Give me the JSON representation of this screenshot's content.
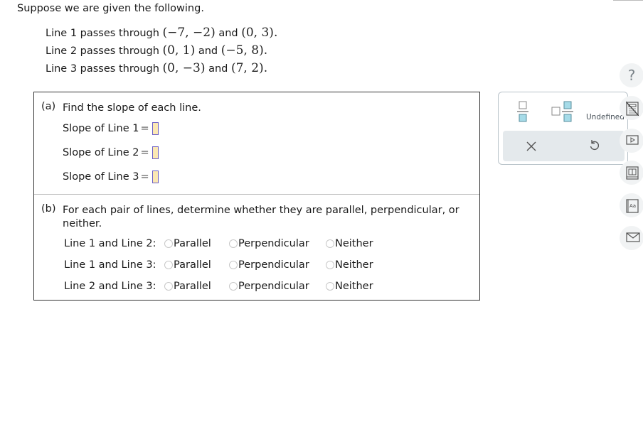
{
  "intro": "Suppose we are given the following.",
  "lines": [
    {
      "prefix": "Line 1 passes through",
      "p1": "(−7, −2)",
      "and": "and",
      "p2": "(0, 3)",
      "end": "."
    },
    {
      "prefix": "Line 2 passes through",
      "p1": "(0, 1)",
      "and": "and",
      "p2": "(−5, 8)",
      "end": "."
    },
    {
      "prefix": "Line 3 passes through",
      "p1": "(0, −3)",
      "and": "and",
      "p2": "(7, 2)",
      "end": "."
    }
  ],
  "part_a": {
    "label": "(a)",
    "text": "Find the slope of each line.",
    "rows": [
      {
        "label": "Slope of Line 1",
        "eq": "=",
        "value": ""
      },
      {
        "label": "Slope of Line 2",
        "eq": "=",
        "value": ""
      },
      {
        "label": "Slope of Line 3",
        "eq": "=",
        "value": ""
      }
    ]
  },
  "part_b": {
    "label": "(b)",
    "text_line1": "For each pair of lines, determine whether they are parallel, perpendicular, or",
    "text_line2": "neither.",
    "options": [
      "Parallel",
      "Perpendicular",
      "Neither"
    ],
    "rows": [
      {
        "label": "Line 1 and Line 2:",
        "selected": null
      },
      {
        "label": "Line 1 and Line 3:",
        "selected": null
      },
      {
        "label": "Line 2 and Line 3:",
        "selected": null
      }
    ]
  },
  "palette": {
    "fraction_icon": "fraction-icon",
    "mixed_number_icon": "mixed-number-icon",
    "undefined_label": "Undefined",
    "clear_icon": "close-icon",
    "undo_icon": "undo-icon"
  },
  "sidebar": {
    "help": "?",
    "icons": [
      "calculator-icon",
      "video-icon",
      "textbook-icon",
      "glossary-icon",
      "message-icon"
    ]
  },
  "colors": {
    "answer_box_fill": "#fbe8b4",
    "answer_box_border": "#6b5fc6",
    "palette_accent": "#a6dbe8"
  }
}
